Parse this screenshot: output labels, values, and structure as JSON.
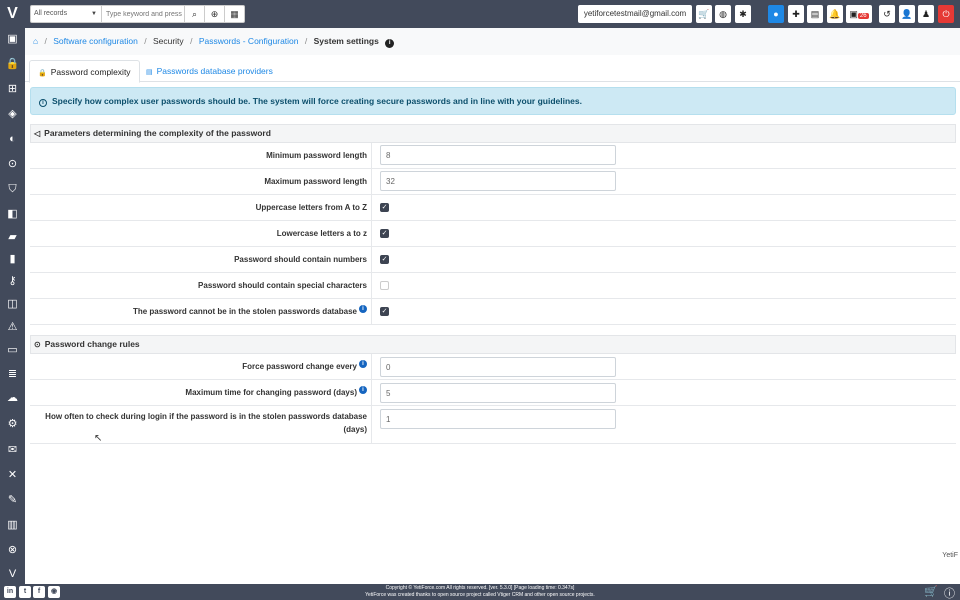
{
  "topbar": {
    "search_scope": "All records",
    "search_placeholder": "Type keyword and press",
    "user_email": "yetiforcetestmail@gmail.com",
    "calendar_badge": "26"
  },
  "breadcrumb": {
    "items": [
      "Software configuration",
      "Security",
      "Passwords - Configuration",
      "System settings"
    ]
  },
  "tabs": {
    "password_complexity": "Password complexity",
    "passwords_db_providers": "Passwords database providers"
  },
  "alert": {
    "text": "Specify how complex user passwords should be. The system will force creating secure passwords and in line with your guidelines."
  },
  "section1": {
    "title": "Parameters determining the complexity of the password",
    "rows": [
      {
        "label": "Minimum password length",
        "value": "8"
      },
      {
        "label": "Maximum password length",
        "value": "32"
      },
      {
        "label": "Uppercase letters from A to Z",
        "checked": true
      },
      {
        "label": "Lowercase letters a to z",
        "checked": true
      },
      {
        "label": "Password should contain numbers",
        "checked": true
      },
      {
        "label": "Password should contain special characters",
        "checked": false
      },
      {
        "label": "The password cannot be in the stolen passwords database",
        "checked": true
      }
    ]
  },
  "section2": {
    "title": "Password change rules",
    "rows": [
      {
        "label": "Force password change every",
        "value": "0"
      },
      {
        "label": "Maximum time for changing password (days)",
        "value": "5"
      },
      {
        "label": "How often to check during login if the password is in the stolen passwords database (days)",
        "value": "1"
      }
    ]
  },
  "footer": {
    "line1": "Copyright © YetiForce.com All rights reserved. [ver. 5.3.0] [Page loading time: 0.347s]",
    "line2": "YetiForce was created thanks to open source project called Vtiger CRM and other open source projects."
  },
  "brand_corner": "YetiF"
}
